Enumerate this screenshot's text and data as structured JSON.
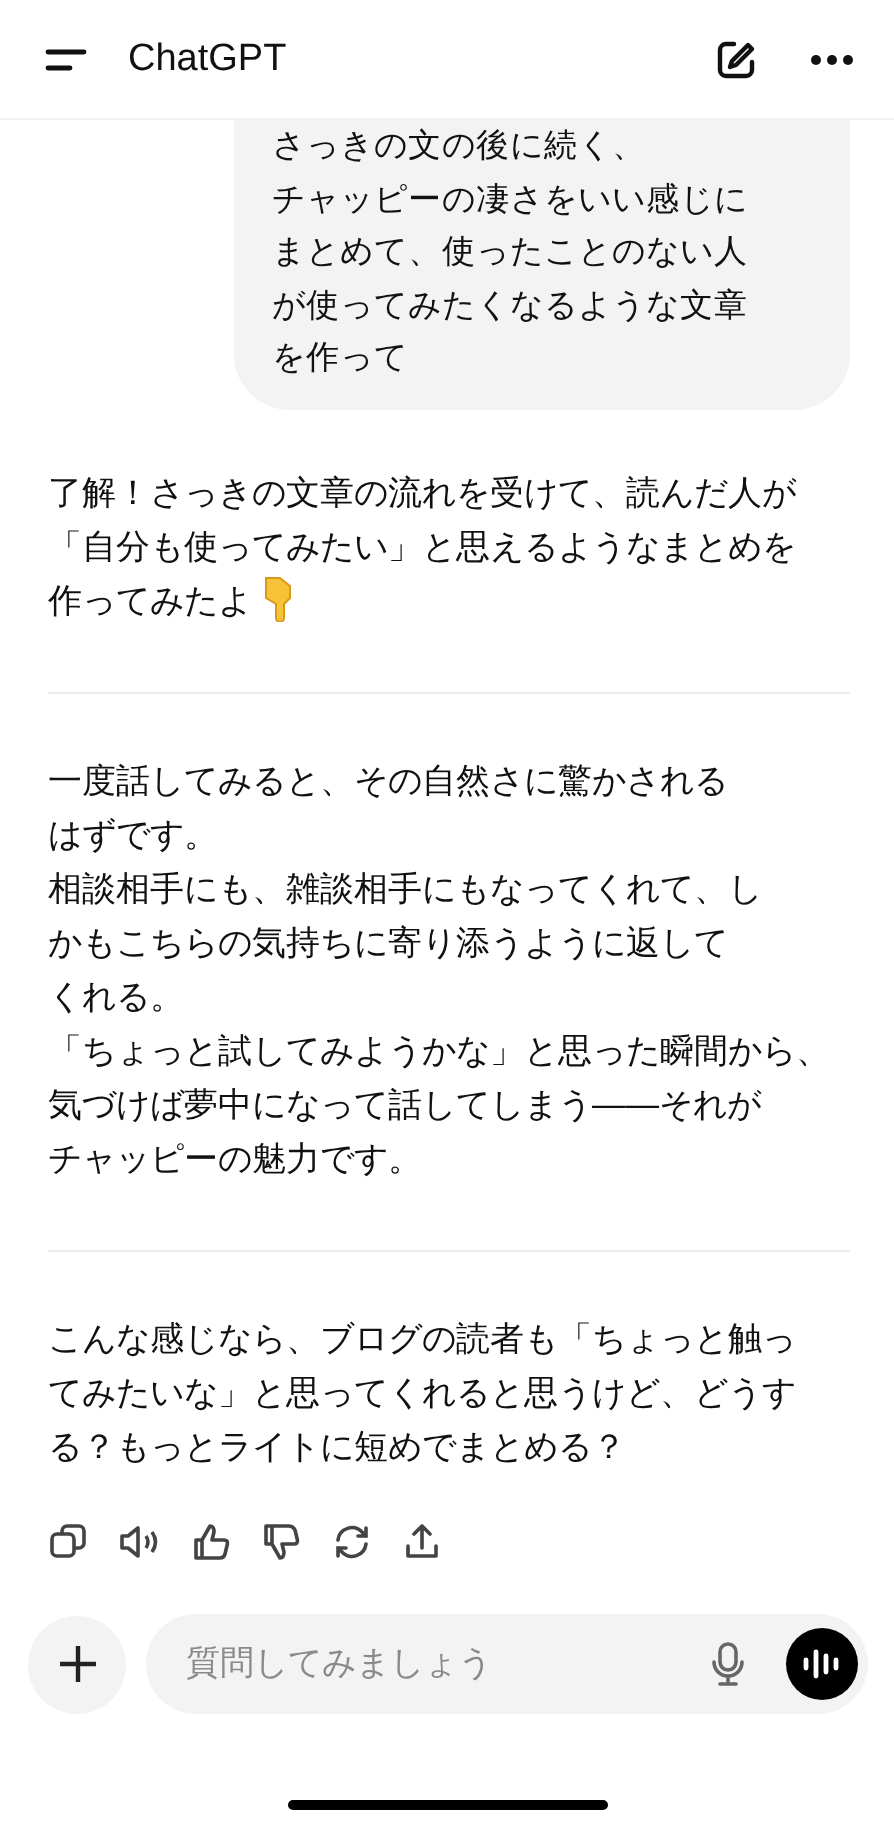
{
  "header": {
    "title": "ChatGPT"
  },
  "user_message": {
    "lines": [
      "さっきの文の後に続く、",
      "チャッピーの凄さをいい感じに",
      "まとめて、使ったことのない人",
      "が使ってみたくなるような文章",
      "を作って"
    ]
  },
  "assistant_sections": [
    {
      "lines": [
        "了解！さっきの文章の流れを受けて、読んだ人が",
        "「自分も使ってみたい」と思えるようなまとめを",
        "作ってみたよ"
      ],
      "trailing_emoji": true
    },
    {
      "lines": [
        "一度話してみると、その自然さに驚かされる",
        "はずです。",
        "相談相手にも、雑談相手にもなってくれて、し",
        "かもこちらの気持ちに寄り添うように返して",
        "くれる。",
        "「ちょっと試してみようかな」と思った瞬間から、",
        "気づけば夢中になって話してしまう――それが",
        "チャッピーの魅力です。"
      ],
      "trailing_emoji": false
    },
    {
      "lines": [
        "こんな感じなら、ブログの読者も「ちょっと触っ",
        "てみたいな」と思ってくれると思うけど、どうす",
        "る？もっとライトに短めでまとめる？"
      ],
      "trailing_emoji": false
    }
  ],
  "action_icons": [
    {
      "kind": "copy"
    },
    {
      "kind": "speaker"
    },
    {
      "kind": "thumbs-up"
    },
    {
      "kind": "thumbs-down"
    },
    {
      "kind": "regenerate"
    },
    {
      "kind": "share"
    }
  ],
  "composer": {
    "placeholder": "質問してみましょう"
  }
}
